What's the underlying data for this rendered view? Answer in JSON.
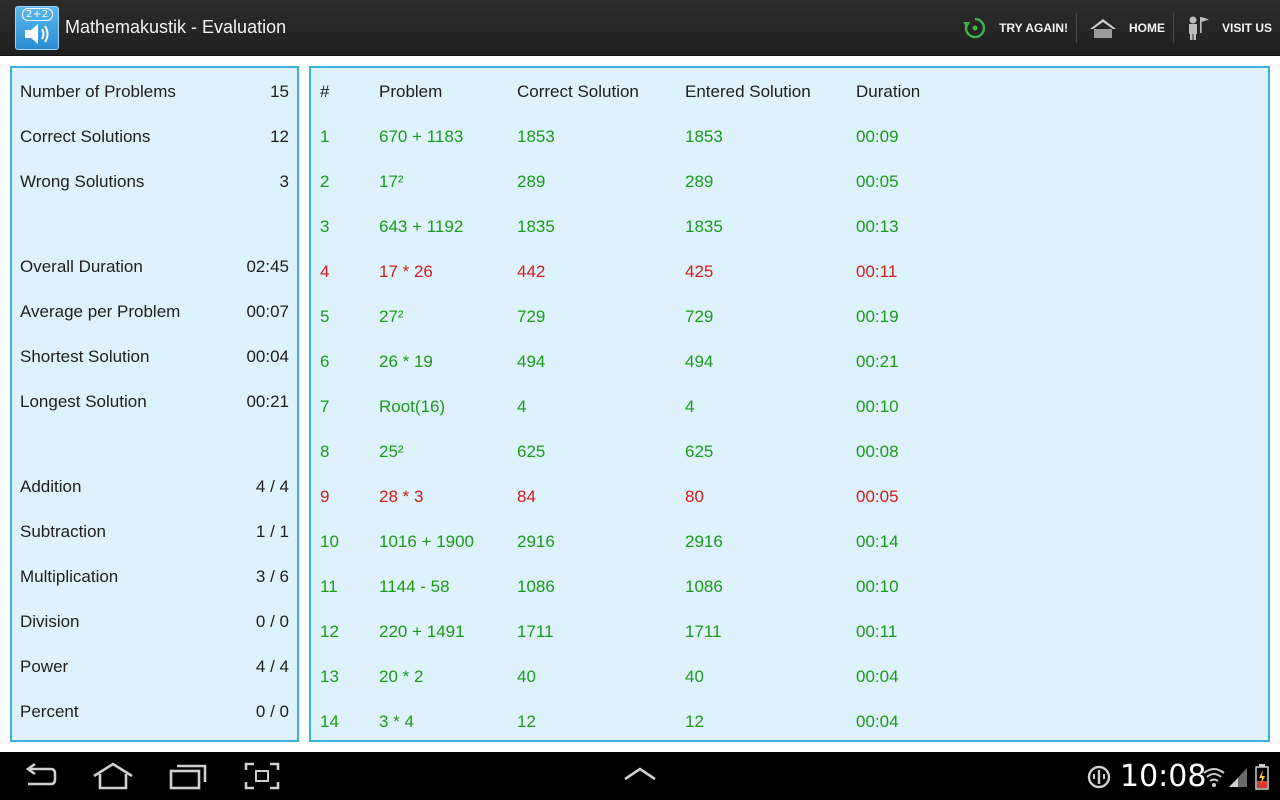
{
  "app": {
    "title": "Mathemakustik - Evaluation",
    "badge": "2+2"
  },
  "actions": {
    "try_again": "TRY AGAIN!",
    "home": "HOME",
    "visit_us": "VISIT US"
  },
  "colors": {
    "correct": "#1c9a1c",
    "wrong": "#d41c1c",
    "panel_bg": "#def2fb",
    "panel_border": "#3ab3dd"
  },
  "summary": {
    "number_of_problems": {
      "label": "Number of Problems",
      "value": "15"
    },
    "correct_solutions": {
      "label": "Correct Solutions",
      "value": "12"
    },
    "wrong_solutions": {
      "label": "Wrong Solutions",
      "value": "3"
    },
    "overall_duration": {
      "label": "Overall Duration",
      "value": "02:45"
    },
    "average_per_problem": {
      "label": "Average per Problem",
      "value": "00:07"
    },
    "shortest_solution": {
      "label": "Shortest Solution",
      "value": "00:04"
    },
    "longest_solution": {
      "label": "Longest Solution",
      "value": "00:21"
    },
    "addition": {
      "label": "Addition",
      "value": "4 / 4"
    },
    "subtraction": {
      "label": "Subtraction",
      "value": "1 / 1"
    },
    "multiplication": {
      "label": "Multiplication",
      "value": "3 / 6"
    },
    "division": {
      "label": "Division",
      "value": "0 / 0"
    },
    "power": {
      "label": "Power",
      "value": "4 / 4"
    },
    "percent": {
      "label": "Percent",
      "value": "0 / 0"
    }
  },
  "table": {
    "headers": {
      "num": "#",
      "problem": "Problem",
      "correct": "Correct Solution",
      "entered": "Entered Solution",
      "duration": "Duration"
    },
    "rows": [
      {
        "num": "1",
        "problem": "670 + 1183",
        "correct": "1853",
        "entered": "1853",
        "duration": "00:09",
        "status": "correct"
      },
      {
        "num": "2",
        "problem": "17²",
        "correct": "289",
        "entered": "289",
        "duration": "00:05",
        "status": "correct"
      },
      {
        "num": "3",
        "problem": "643 + 1192",
        "correct": "1835",
        "entered": "1835",
        "duration": "00:13",
        "status": "correct"
      },
      {
        "num": "4",
        "problem": "17 * 26",
        "correct": "442",
        "entered": "425",
        "duration": "00:11",
        "status": "wrong"
      },
      {
        "num": "5",
        "problem": "27²",
        "correct": "729",
        "entered": "729",
        "duration": "00:19",
        "status": "correct"
      },
      {
        "num": "6",
        "problem": "26 * 19",
        "correct": "494",
        "entered": "494",
        "duration": "00:21",
        "status": "correct"
      },
      {
        "num": "7",
        "problem": "Root(16)",
        "correct": "4",
        "entered": "4",
        "duration": "00:10",
        "status": "correct"
      },
      {
        "num": "8",
        "problem": "25²",
        "correct": "625",
        "entered": "625",
        "duration": "00:08",
        "status": "correct"
      },
      {
        "num": "9",
        "problem": "28 * 3",
        "correct": "84",
        "entered": "80",
        "duration": "00:05",
        "status": "wrong"
      },
      {
        "num": "10",
        "problem": "1016 + 1900",
        "correct": "2916",
        "entered": "2916",
        "duration": "00:14",
        "status": "correct"
      },
      {
        "num": "11",
        "problem": "1144 - 58",
        "correct": "1086",
        "entered": "1086",
        "duration": "00:10",
        "status": "correct"
      },
      {
        "num": "12",
        "problem": "220 + 1491",
        "correct": "1711",
        "entered": "1711",
        "duration": "00:11",
        "status": "correct"
      },
      {
        "num": "13",
        "problem": "20 * 2",
        "correct": "40",
        "entered": "40",
        "duration": "00:04",
        "status": "correct"
      },
      {
        "num": "14",
        "problem": "3 * 4",
        "correct": "12",
        "entered": "12",
        "duration": "00:04",
        "status": "correct"
      }
    ]
  },
  "status_bar": {
    "clock": "10:08"
  },
  "icons": [
    "app-speaker-icon",
    "refresh-icon",
    "home-icon",
    "visitor-icon",
    "back-icon",
    "home-nav-icon",
    "recent-apps-icon",
    "screenshot-icon",
    "chevron-up-icon",
    "usb-debug-icon",
    "wifi-icon",
    "signal-icon",
    "battery-icon"
  ]
}
